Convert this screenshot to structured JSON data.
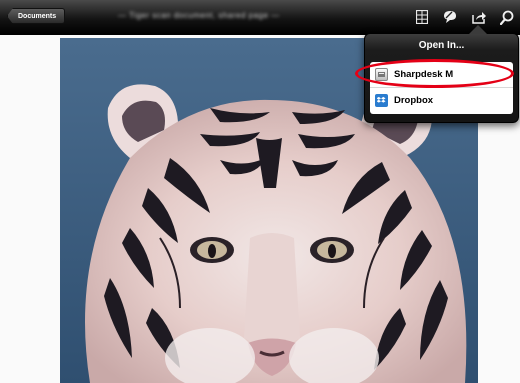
{
  "toolbar": {
    "documents_label": "Documents",
    "doc_title": "— Tiger scan document, shared page —",
    "icons": [
      "grid-icon",
      "annotation-bubble-icon",
      "share-icon",
      "search-icon"
    ]
  },
  "open_in": {
    "title": "Open In...",
    "apps": [
      {
        "label": "Sharpdesk M",
        "icon": "sharpdesk-app-icon"
      },
      {
        "label": "Dropbox",
        "icon": "dropbox-app-icon"
      }
    ]
  },
  "colors": {
    "toolbar_bg": "#141414",
    "highlight": "#e40016",
    "dropbox_blue": "#2a7ccf"
  }
}
